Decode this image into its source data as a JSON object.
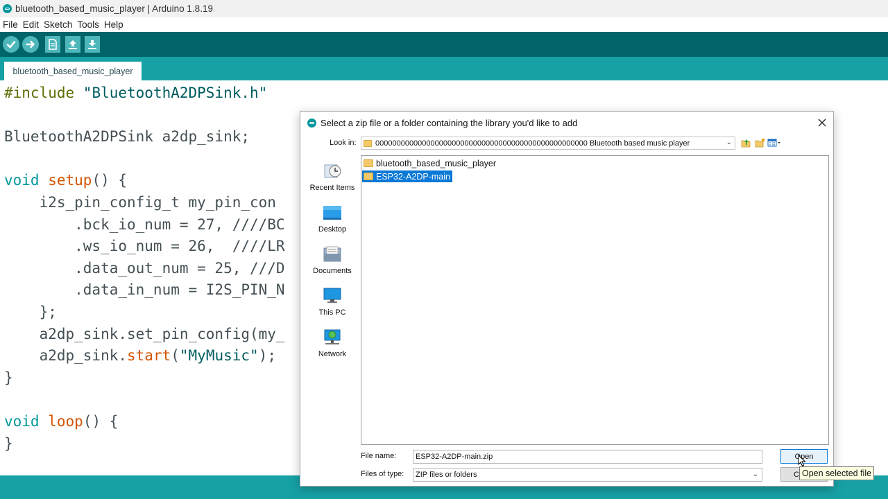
{
  "window": {
    "title": "bluetooth_based_music_player | Arduino 1.8.19"
  },
  "menu": {
    "items": [
      "File",
      "Edit",
      "Sketch",
      "Tools",
      "Help"
    ]
  },
  "toolbar": {
    "buttons": [
      "verify-icon",
      "upload-icon",
      "new-icon",
      "open-icon",
      "save-icon"
    ]
  },
  "tabs": [
    "bluetooth_based_music_player"
  ],
  "editor": {
    "lines": [
      {
        "parts": [
          [
            "pp",
            "#include "
          ],
          [
            "str",
            "\"BluetoothA2DPSink.h\""
          ]
        ]
      },
      {
        "parts": [
          [
            "plain",
            ""
          ]
        ]
      },
      {
        "parts": [
          [
            "plain",
            "BluetoothA2DPSink a2dp_sink;"
          ]
        ]
      },
      {
        "parts": [
          [
            "plain",
            ""
          ]
        ]
      },
      {
        "parts": [
          [
            "type",
            "void"
          ],
          [
            "plain",
            " "
          ],
          [
            "fn",
            "setup"
          ],
          [
            "plain",
            "() {"
          ]
        ]
      },
      {
        "parts": [
          [
            "plain",
            "    i2s_pin_config_t my_pin_con"
          ]
        ]
      },
      {
        "parts": [
          [
            "plain",
            "        .bck_io_num = 27, ////BC"
          ]
        ]
      },
      {
        "parts": [
          [
            "plain",
            "        .ws_io_num = 26,  ////LR"
          ]
        ]
      },
      {
        "parts": [
          [
            "plain",
            "        .data_out_num = 25, ///D"
          ]
        ]
      },
      {
        "parts": [
          [
            "plain",
            "        .data_in_num = I2S_PIN_N"
          ]
        ]
      },
      {
        "parts": [
          [
            "plain",
            "    };"
          ]
        ]
      },
      {
        "parts": [
          [
            "plain",
            "    a2dp_sink.set_pin_config(my_"
          ]
        ]
      },
      {
        "parts": [
          [
            "plain",
            "    a2dp_sink."
          ],
          [
            "fn",
            "start"
          ],
          [
            "plain",
            "("
          ],
          [
            "str",
            "\"MyMusic\""
          ],
          [
            "plain",
            ");"
          ]
        ]
      },
      {
        "parts": [
          [
            "plain",
            "}"
          ]
        ]
      },
      {
        "parts": [
          [
            "plain",
            ""
          ]
        ]
      },
      {
        "parts": [
          [
            "type",
            "void"
          ],
          [
            "plain",
            " "
          ],
          [
            "fn",
            "loop"
          ],
          [
            "plain",
            "() {"
          ]
        ]
      },
      {
        "parts": [
          [
            "plain",
            "}"
          ]
        ]
      }
    ]
  },
  "dialog": {
    "title": "Select a zip file or a folder containing the library you'd like to add",
    "look_in_label": "Look in:",
    "look_in_value": "00000000000000000000000000000000000000000000000000 Bluetooth based music player",
    "places": [
      "Recent Items",
      "Desktop",
      "Documents",
      "This PC",
      "Network"
    ],
    "files": [
      {
        "name": "bluetooth_based_music_player",
        "selected": false
      },
      {
        "name": "ESP32-A2DP-main",
        "selected": true
      }
    ],
    "file_name_label": "File name:",
    "file_name_value": "ESP32-A2DP-main.zip",
    "file_type_label": "Files of type:",
    "file_type_value": "ZIP files or folders",
    "open_button": "Open",
    "cancel_button": "Cancel",
    "tooltip": "Open selected file"
  },
  "colors": {
    "toolbar": "#006468",
    "tabbar": "#17a1a5",
    "selection": "#0a78d7"
  }
}
